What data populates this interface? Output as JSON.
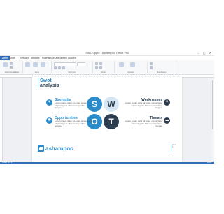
{
  "window": {
    "title": "SWOT.pptx - Ashampoo Office Pro"
  },
  "ribbon_tabs": [
    "Datei",
    "Start",
    "Einfügen",
    "Ansicht",
    "Folienshow",
    "Überprüfen",
    "Ansicht"
  ],
  "ribbon_groups": [
    "Zwischenablage",
    "Folie",
    "Schriftart",
    "Absatz",
    "Objekte",
    "Bearbeiten"
  ],
  "slide": {
    "title_1": "Swot",
    "title_2": "analysis",
    "letters": [
      "S",
      "W",
      "O",
      "T"
    ],
    "strengths": {
      "heading": "Strengths",
      "text": "Lorem ipsum dolor sit amet, consectetur adipiscing elit. Maecenas porttitor congue."
    },
    "weaknesses": {
      "heading": "Weaknesses",
      "text": "Lorem ipsum dolor sit amet, consectetur adipiscing elit. Maecenas porttitor congue."
    },
    "opportunities": {
      "heading": "Opportunities",
      "text": "Lorem ipsum dolor sit amet, consectetur adipiscing elit. Maecenas porttitor congue."
    },
    "threats": {
      "heading": "Threats",
      "text": "Lorem ipsum dolor sit amet, consectetur adipiscing elit. Maecenas porttitor congue."
    },
    "logo_text": "ashampoo",
    "footer": "Seite 1"
  },
  "statusbar": {
    "left": "Folie 1 von 1",
    "right": "100%"
  },
  "colors": {
    "accent": "#2b8ccb",
    "dark": "#2c3e50",
    "light": "#d6e7f3",
    "ribbon_active": "#2f6fb7"
  }
}
